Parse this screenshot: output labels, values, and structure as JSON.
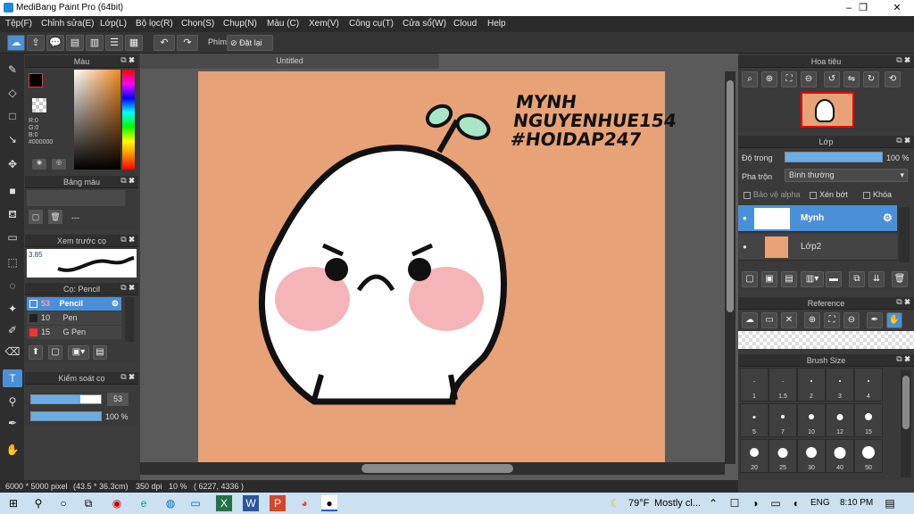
{
  "window": {
    "title": "MediBang Paint Pro (64bit)",
    "minimize": "–",
    "maximize": "❐",
    "close": "✕"
  },
  "menu": [
    "Tệp(F)",
    "Chỉnh sửa(E)",
    "Lớp(L)",
    "Bộ lọc(R)",
    "Chọn(S)",
    "Chụp(N)",
    "Màu (C)",
    "Xem(V)",
    "Công cụ(T)",
    "Cửa sổ(W)",
    "Cloud",
    "Help"
  ],
  "toolbar": {
    "shortcut_label": "Phím",
    "reset_label": "Đặt lại"
  },
  "panels": {
    "color": {
      "title": "Màu",
      "r": "R:0",
      "g": "G:0",
      "b": "B:0",
      "hex": "#000000"
    },
    "palette": {
      "title": "Bảng màu",
      "dash": "---"
    },
    "brush_preview": {
      "title": "Xem trước cọ",
      "size": "3.85"
    },
    "brush": {
      "title": "Cọ: Pencil",
      "items": [
        {
          "size": "53",
          "name": "Pencil"
        },
        {
          "size": "10",
          "name": "Pen"
        },
        {
          "size": "15",
          "name": "G Pen"
        }
      ]
    },
    "brush_control": {
      "title": "Kiểm soát cọ",
      "size": "53",
      "opacity": "100 %"
    },
    "navigator": {
      "title": "Hoa tiêu"
    },
    "layer": {
      "title": "Lớp",
      "opacity_label": "Độ trong",
      "opacity_value": "100 %",
      "blend_label": "Pha trộn",
      "blend_value": "Bình thường",
      "protect_alpha": "Bảo vệ alpha",
      "clipping": "Xén bớt",
      "lock": "Khóa",
      "layers": [
        {
          "name": "Mynh"
        },
        {
          "name": "Lớp2"
        }
      ]
    },
    "reference": {
      "title": "Reference"
    },
    "brush_size": {
      "title": "Brush Size",
      "sizes": [
        "1",
        "1.5",
        "2",
        "3",
        "4",
        "5",
        "7",
        "10",
        "12",
        "15",
        "20",
        "25",
        "30",
        "40",
        "50"
      ]
    }
  },
  "canvas": {
    "tab": "Untitled",
    "text_line1": "MYNH",
    "text_line2": "NGUYENHUE154",
    "text_line3": "#HOIDAP247"
  },
  "status": {
    "dimensions": "6000 * 5000 pixel",
    "cm": "(43.5 * 36.3cm)",
    "dpi": "350 dpi",
    "zoom": "10 %",
    "coords": "( 6227, 4336 )"
  },
  "taskbar": {
    "weather": "79°F",
    "weather_desc": "Mostly cl...",
    "lang": "ENG",
    "time": "8:10 PM"
  },
  "colors": {
    "bg": "#e7a277",
    "accent": "#4a90d9"
  }
}
